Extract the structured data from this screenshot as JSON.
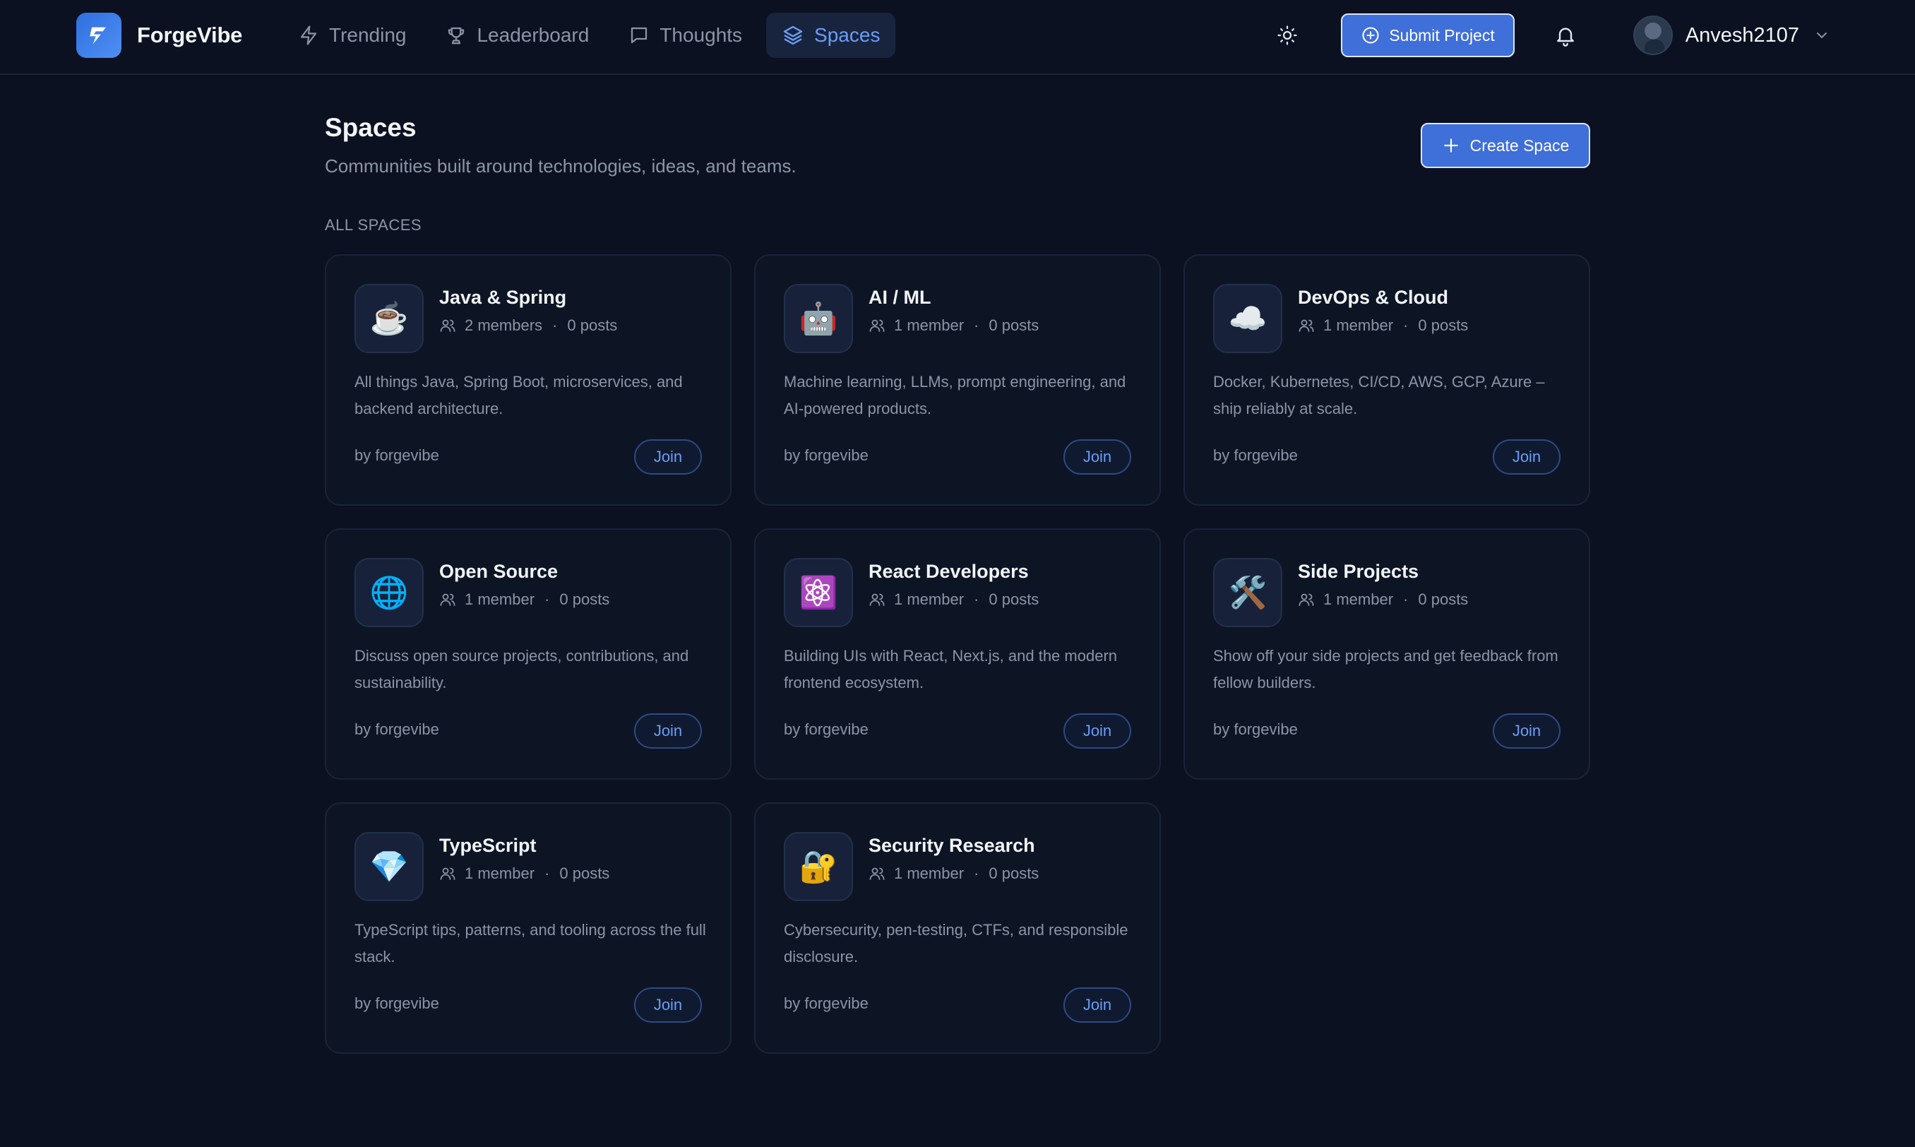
{
  "app": {
    "name": "ForgeVibe",
    "logo_icon": "lightning-flag-icon",
    "accent_color": "#3f6fd9"
  },
  "nav": {
    "items": [
      {
        "label": "Trending",
        "icon": "lightning-icon",
        "active": false
      },
      {
        "label": "Leaderboard",
        "icon": "trophy-icon",
        "active": false
      },
      {
        "label": "Thoughts",
        "icon": "message-square-icon",
        "active": false
      },
      {
        "label": "Spaces",
        "icon": "layers-icon",
        "active": true
      }
    ]
  },
  "toolbar": {
    "theme_icon": "sun-icon",
    "submit_label": "Submit Project",
    "notifications_icon": "bell-icon"
  },
  "user": {
    "name": "Anvesh2107"
  },
  "page": {
    "title": "Spaces",
    "subtitle": "Communities built around technologies, ideas, and teams.",
    "create_label": "Create Space",
    "section_label": "ALL SPACES"
  },
  "spaces": [
    {
      "icon": "☕",
      "name": "Java & Spring",
      "members": "2 members",
      "posts": "0 posts",
      "description": "All things Java, Spring Boot, microservices, and backend architecture.",
      "owner": "by forgevibe",
      "action": "Join"
    },
    {
      "icon": "🤖",
      "name": "AI / ML",
      "members": "1 member",
      "posts": "0 posts",
      "description": "Machine learning, LLMs, prompt engineering, and AI-powered products.",
      "owner": "by forgevibe",
      "action": "Join"
    },
    {
      "icon": "☁️",
      "name": "DevOps & Cloud",
      "members": "1 member",
      "posts": "0 posts",
      "description": "Docker, Kubernetes, CI/CD, AWS, GCP, Azure – ship reliably at scale.",
      "owner": "by forgevibe",
      "action": "Join"
    },
    {
      "icon": "🌐",
      "name": "Open Source",
      "members": "1 member",
      "posts": "0 posts",
      "description": "Discuss open source projects, contributions, and sustainability.",
      "owner": "by forgevibe",
      "action": "Join"
    },
    {
      "icon": "⚛️",
      "name": "React Developers",
      "members": "1 member",
      "posts": "0 posts",
      "description": "Building UIs with React, Next.js, and the modern frontend ecosystem.",
      "owner": "by forgevibe",
      "action": "Join"
    },
    {
      "icon": "🛠️",
      "name": "Side Projects",
      "members": "1 member",
      "posts": "0 posts",
      "description": "Show off your side projects and get feedback from fellow builders.",
      "owner": "by forgevibe",
      "action": "Join"
    },
    {
      "icon": "💎",
      "name": "TypeScript",
      "members": "1 member",
      "posts": "0 posts",
      "description": "TypeScript tips, patterns, and tooling across the full stack.",
      "owner": "by forgevibe",
      "action": "Join"
    },
    {
      "icon": "🔐",
      "name": "Security Research",
      "members": "1 member",
      "posts": "0 posts",
      "description": "Cybersecurity, pen-testing, CTFs, and responsible disclosure.",
      "owner": "by forgevibe",
      "action": "Join"
    }
  ]
}
